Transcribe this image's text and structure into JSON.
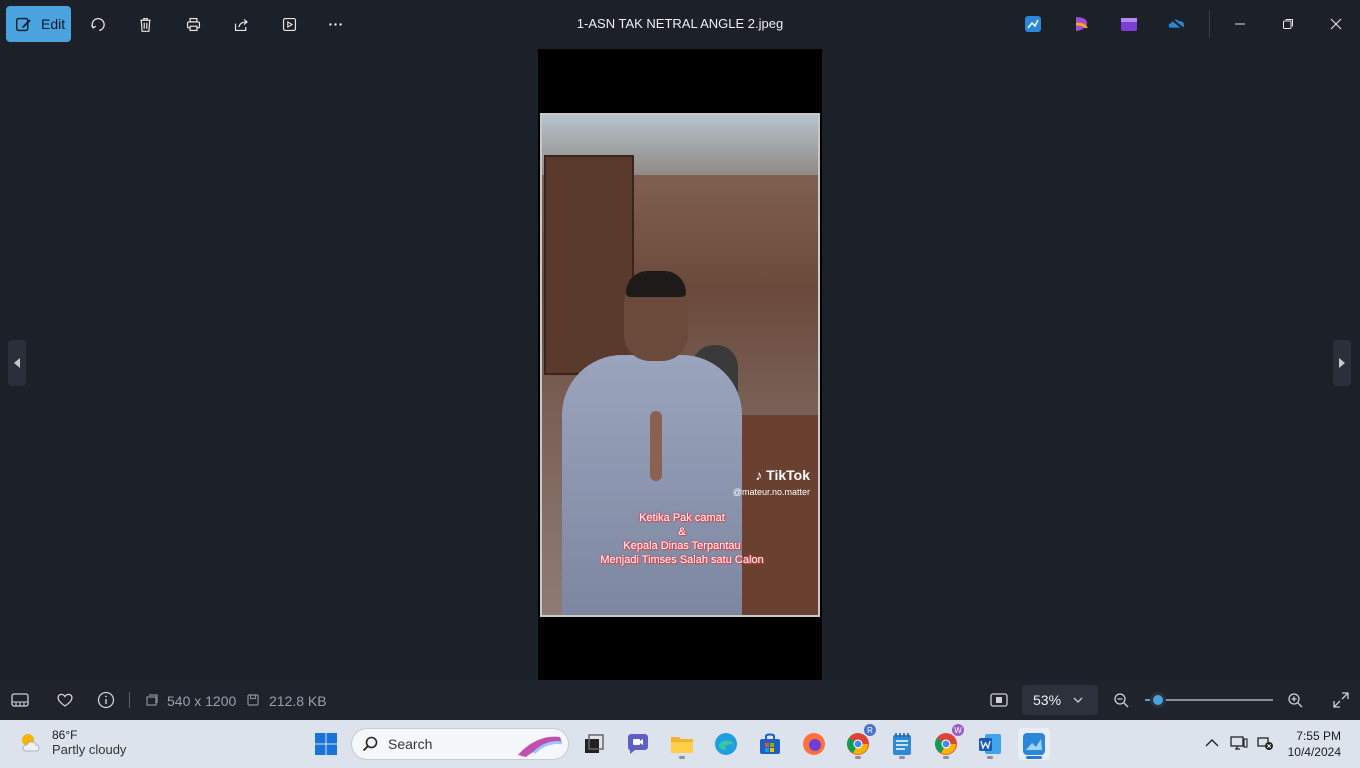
{
  "window": {
    "title": "1-ASN TAK NETRAL ANGLE 2.jpeg"
  },
  "toolbar": {
    "edit_label": "Edit",
    "icons": [
      "rotate-icon",
      "delete-icon",
      "print-icon",
      "share-icon",
      "slideshow-icon",
      "more-icon"
    ]
  },
  "photo": {
    "watermark_brand": "TikTok",
    "watermark_handle": "@mateur.no.matter",
    "caption_lines": [
      "Ketika Pak camat",
      "&",
      "Kepala Dinas Terpantau",
      "Menjadi Timses Salah satu Calon"
    ]
  },
  "statusbar": {
    "dimensions": "540 x 1200",
    "file_size": "212.8 KB",
    "zoom": "53%",
    "zoom_fraction": 0.1
  },
  "taskbar": {
    "weather_temp": "86°F",
    "weather_condition": "Partly cloudy",
    "search_placeholder": "Search",
    "time": "7:55 PM",
    "date": "10/4/2024",
    "chrome_badge_1": "R",
    "chrome_badge_2": "W"
  },
  "colors": {
    "accent": "#4aa3df",
    "background": "#1c2029",
    "taskbar": "#dce3ec"
  }
}
